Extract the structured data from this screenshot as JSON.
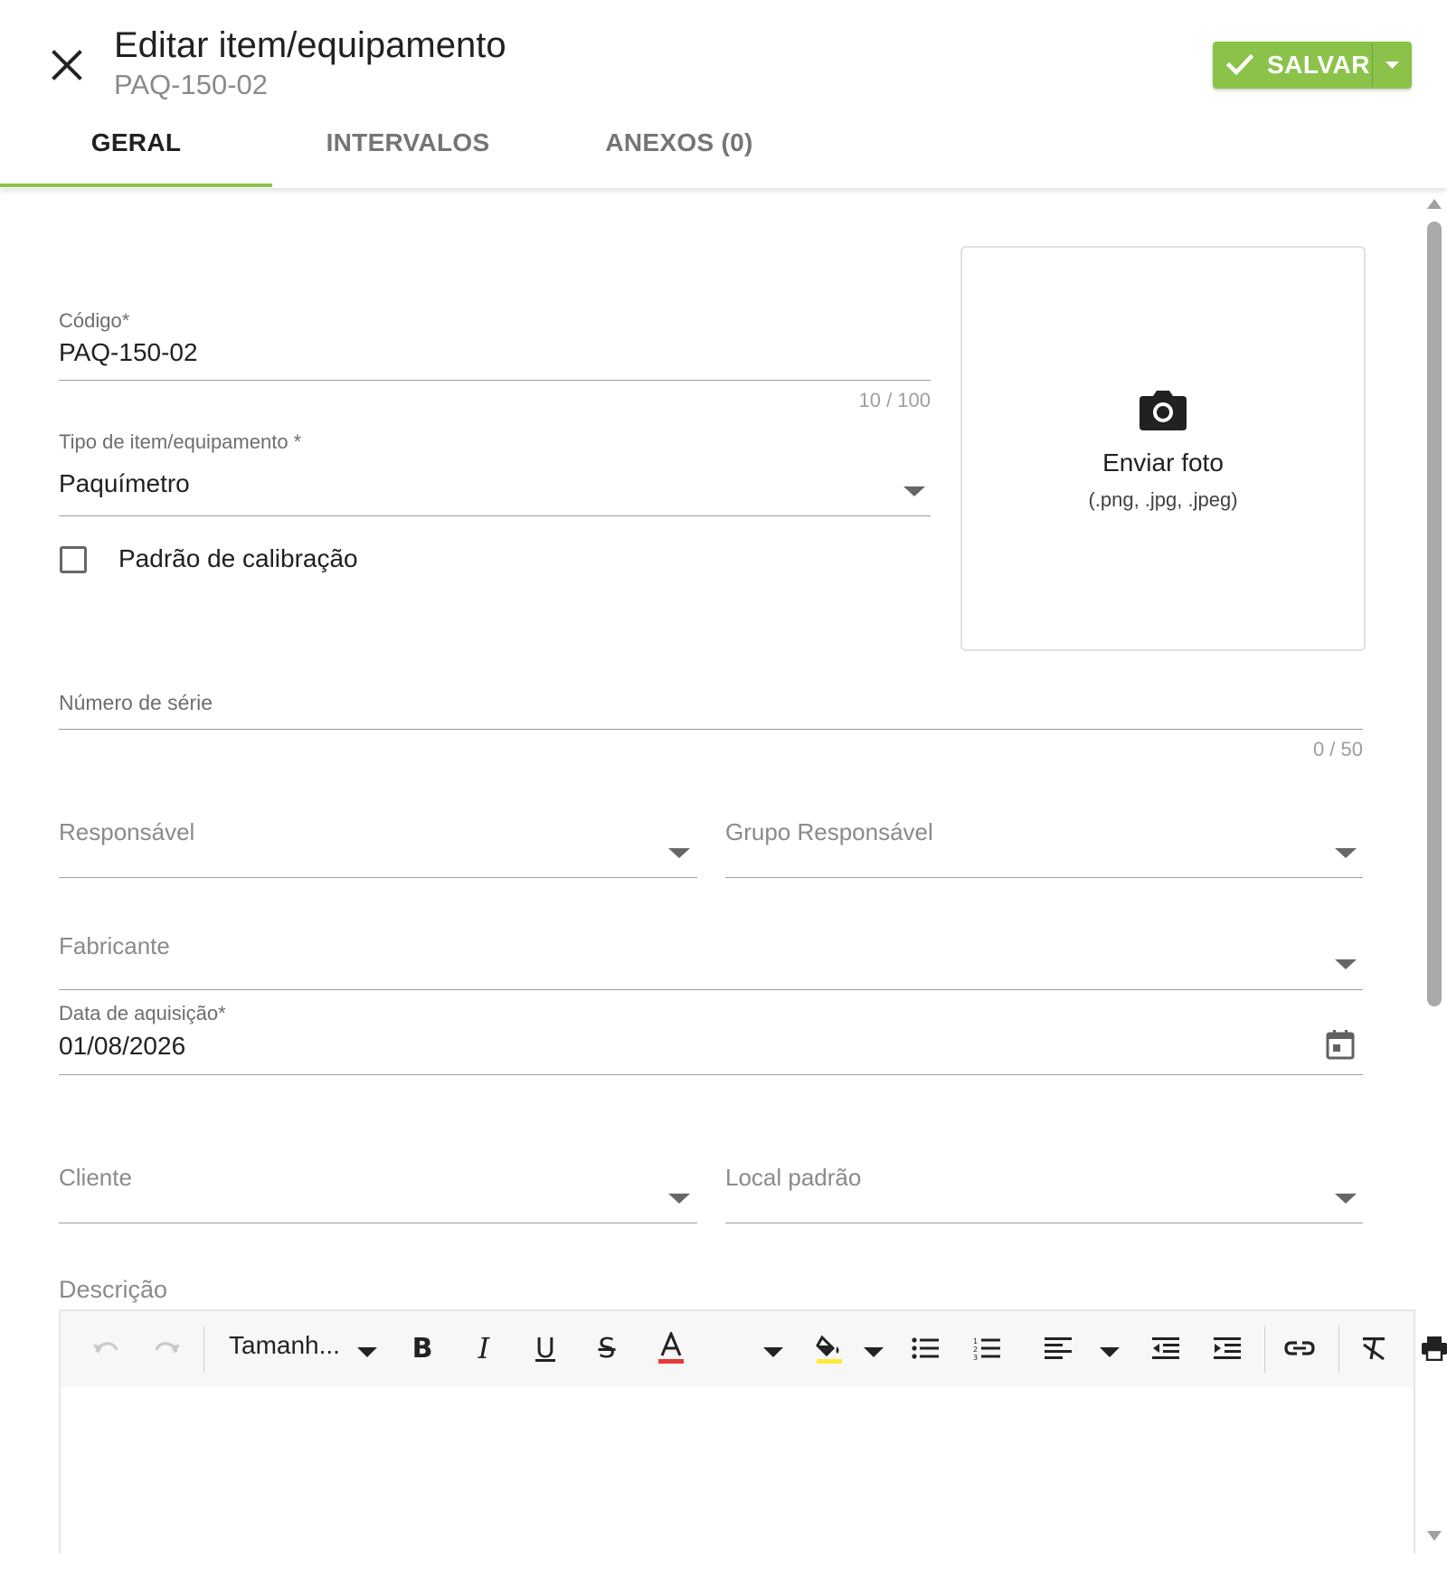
{
  "header": {
    "title": "Editar item/equipamento",
    "subtitle": "PAQ-150-02",
    "save_label": "SALVAR",
    "tabs": [
      {
        "label": "GERAL",
        "active": true
      },
      {
        "label": "INTERVALOS",
        "active": false
      },
      {
        "label": "ANEXOS (0)",
        "active": false
      }
    ]
  },
  "colors": {
    "accent": "#8bc34a",
    "font_color_bar": "#e53935",
    "highlight_bar": "#ffeb3b"
  },
  "form": {
    "codigo": {
      "label": "Código*",
      "value": "PAQ-150-02",
      "counter": "10 / 100"
    },
    "tipo": {
      "label": "Tipo de item/equipamento *",
      "value": "Paquímetro"
    },
    "padrao": {
      "label": "Padrão de calibração",
      "checked": false
    },
    "photo": {
      "label": "Enviar foto",
      "hint": "(.png, .jpg, .jpeg)",
      "icon": "camera-icon"
    },
    "numero_serie": {
      "label": "Número de série",
      "value": "",
      "counter": "0 / 50"
    },
    "responsavel": {
      "label": "Responsável",
      "value": ""
    },
    "grupo_responsavel": {
      "label": "Grupo Responsável",
      "value": ""
    },
    "fabricante": {
      "label": "Fabricante",
      "value": ""
    },
    "data_aquisicao": {
      "label": "Data de aquisição*",
      "value": "01/08/2026",
      "icon": "calendar-icon"
    },
    "cliente": {
      "label": "Cliente",
      "value": ""
    },
    "local_padrao": {
      "label": "Local padrão",
      "value": ""
    },
    "descricao": {
      "label": "Descrição",
      "value": ""
    }
  },
  "editor": {
    "font_size_label": "Tamanh...",
    "tools": [
      "undo-icon",
      "redo-icon",
      "font-size-select",
      "bold-icon",
      "italic-icon",
      "underline-icon",
      "strikethrough-icon",
      "font-color-icon",
      "highlight-color-icon",
      "bullet-list-icon",
      "numbered-list-icon",
      "align-icon",
      "outdent-icon",
      "indent-icon",
      "link-icon",
      "clear-format-icon",
      "print-icon"
    ]
  }
}
